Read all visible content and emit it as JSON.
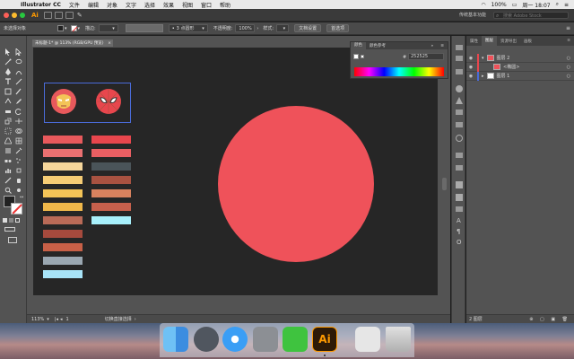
{
  "menubar": {
    "app_name": "Illustrator CC",
    "items": [
      "文件",
      "编辑",
      "对象",
      "文字",
      "选择",
      "效果",
      "视图",
      "窗口",
      "帮助"
    ],
    "battery": "100%",
    "clock": "周一 18:07"
  },
  "appbar": {
    "logo": "Ai",
    "workspace": "传统基本功能",
    "search_placeholder": "搜索 Adobe Stock"
  },
  "control_bar": {
    "selection_label": "未选择对象",
    "stroke_label": "描边:",
    "brush_label": "3 点圆形",
    "opacity_label": "不透明度:",
    "opacity_value": "100%",
    "style_label": "样式:",
    "doc_setup": "文档设置",
    "preferences": "首选项"
  },
  "document": {
    "tab_title": "未标题-1* @ 113% (RGB/GPU 预览)",
    "zoom": "113%",
    "page": "1",
    "status_tool": "切换直接选择"
  },
  "color_panel": {
    "tabs": [
      "颜色",
      "颜色参考"
    ],
    "hex_label": "#",
    "hex_value": "252525"
  },
  "layers_panel": {
    "tabs": [
      "属性",
      "图层",
      "资源导出",
      "画板"
    ],
    "layers": [
      {
        "name": "图层 2",
        "color": "#e8464d"
      },
      {
        "name": "<椭圆>",
        "color": "#e8464d"
      },
      {
        "name": "图层 1",
        "color": "#4a6bd8"
      }
    ],
    "footer": "2 图层"
  },
  "artwork": {
    "circle_color": "#ef525a",
    "swatches_left": [
      "#e8595c",
      "#ea7071",
      "#f5d69b",
      "#f5cc75",
      "#f3c457",
      "#f0b84a",
      "#b96a57",
      "#a64a3d",
      "#c86047",
      "#9aa7b1",
      "#a8e4f8"
    ],
    "swatches_right": [
      "#e8464d",
      "#ea5f63",
      "#4a5459",
      "#a85241",
      "#d9825e",
      "#c7604c",
      "#a8f0fb"
    ]
  },
  "dock": {
    "icons": [
      "finder-icon",
      "launchpad-icon",
      "safari-icon",
      "system-preferences-icon",
      "wechat-icon",
      "illustrator-icon",
      "preview-icon",
      "trash-icon"
    ],
    "ai_label": "Ai"
  },
  "colors": {
    "accent": "#ff9a00",
    "panel": "#535353",
    "canvas": "#262626"
  }
}
